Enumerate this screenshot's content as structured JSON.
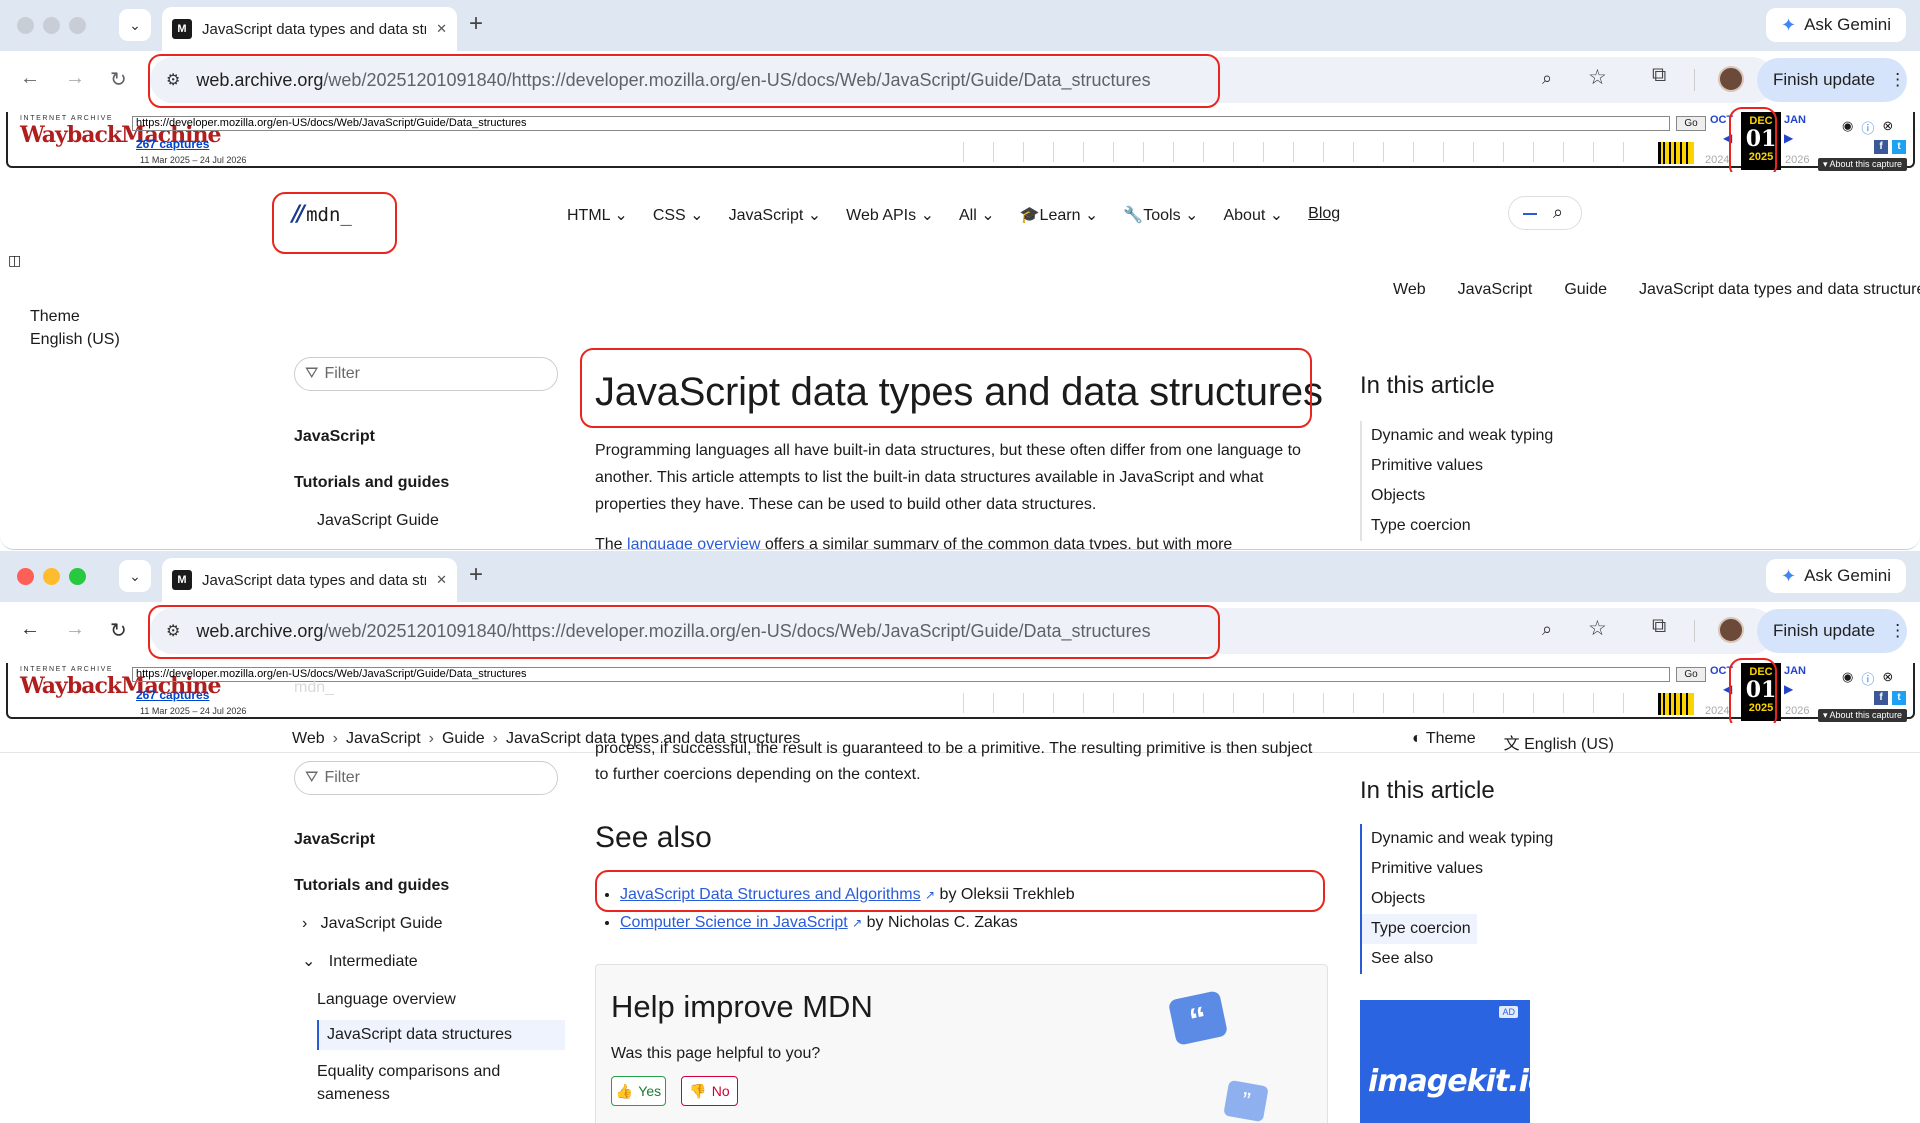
{
  "browser": {
    "tab_title": "JavaScript data types and data structures",
    "favicon": "M",
    "ask_gemini": "Ask Gemini",
    "url_host": "web.archive.org",
    "url_path": "/web/20251201091840/https://developer.mozilla.org/en-US/docs/Web/JavaScript/Guide/Data_structures",
    "finish_update": "Finish update"
  },
  "wayback": {
    "label_top": "INTERNET ARCHIVE",
    "logo": "WaybackMachine",
    "url": "https://developer.mozilla.org/en-US/docs/Web/JavaScript/Guide/Data_structures",
    "go": "Go",
    "captures": "267 captures",
    "range": "11 Mar 2025 – 24 Jul 2026",
    "prev_month": "OCT",
    "next_month": "JAN",
    "month": "DEC",
    "day": "01",
    "year": "2025",
    "prev_year": "2024",
    "next_year": "2026",
    "about": "▾ About this capture"
  },
  "mdn": {
    "logo_text": "mdn_",
    "nav": [
      "HTML",
      "CSS",
      "JavaScript",
      "Web APIs",
      "All",
      "Learn",
      "Tools",
      "About"
    ],
    "blog": "Blog",
    "breadcrumbs": [
      "Web",
      "JavaScript",
      "Guide",
      "JavaScript data types and data structures"
    ],
    "theme": "Theme",
    "language": "English (US)",
    "filter_placeholder": "Filter",
    "sidebar": {
      "heading": "JavaScript",
      "section": "Tutorials and guides",
      "guide": "JavaScript Guide",
      "intermediate": "Intermediate",
      "items": [
        "Language overview",
        "JavaScript data structures",
        "Equality comparisons and sameness"
      ]
    },
    "title": "JavaScript data types and data structures",
    "intro": "Programming languages all have built-in data structures, but these often differ from one language to another. This article attempts to list the built-in data structures available in JavaScript and what properties they have. These can be used to build other data structures.",
    "intro2_pre": "The ",
    "intro2_link": "language overview",
    "intro2_post": " offers a similar summary of the common data types, but with more",
    "toc_title": "In this article",
    "toc": [
      "Dynamic and weak typing",
      "Primitive values",
      "Objects",
      "Type coercion",
      "See also"
    ],
    "cut_text": "process, if successful, the result is guaranteed to be a primitive. The resulting primitive is then subject to further coercions depending on the context.",
    "see_also": "See also",
    "see_also_items": [
      {
        "link": "JavaScript Data Structures and Algorithms",
        "by": " by Oleksii Trekhleb"
      },
      {
        "link": "Computer Science in JavaScript",
        "by": " by Nicholas C. Zakas"
      }
    ],
    "help_title": "Help improve MDN",
    "help_question": "Was this page helpful to you?",
    "yes": "Yes",
    "no": "No",
    "ad_tag": "AD",
    "ad_brand": "imagekit.io"
  }
}
